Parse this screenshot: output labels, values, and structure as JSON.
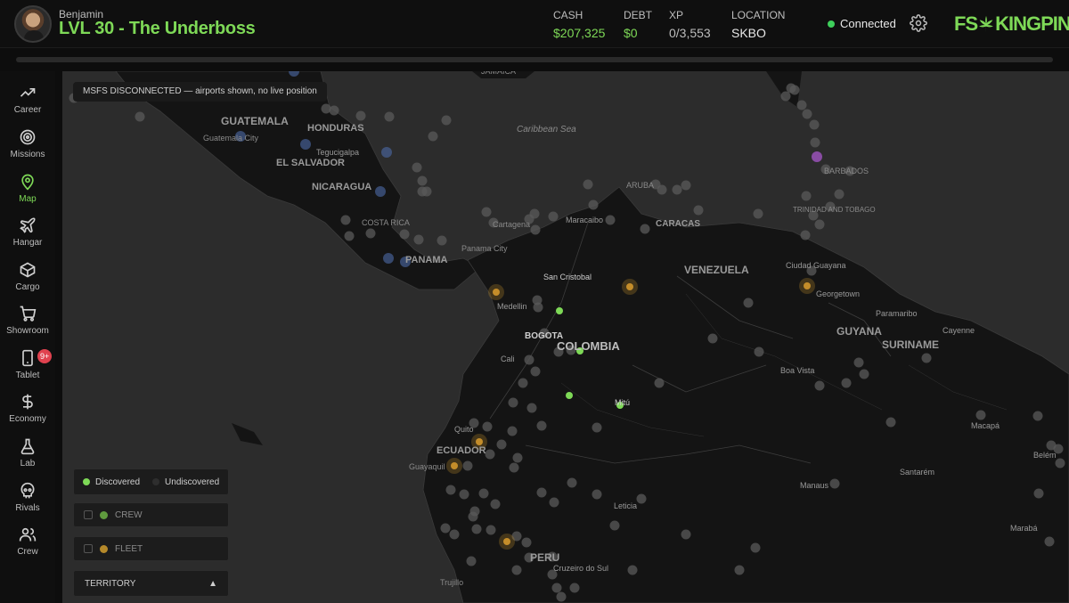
{
  "player": {
    "name": "Benjamin",
    "level_title": "LVL 30 - The Underboss"
  },
  "stats": {
    "cash_label": "CASH",
    "cash_value": "$207,325",
    "debt_label": "DEBT",
    "debt_value": "$0",
    "xp_label": "XP",
    "xp_value": "0/3,553",
    "location_label": "LOCATION",
    "location_value": "SKBO"
  },
  "status": {
    "connected_label": "Connected"
  },
  "brand": {
    "left": "FS",
    "right": "KINGPIN",
    "accent": "#7ed957"
  },
  "xp_progress": 0.0,
  "sidebar": {
    "items": [
      {
        "label": "Career",
        "icon": "trending-up-icon"
      },
      {
        "label": "Missions",
        "icon": "target-icon"
      },
      {
        "label": "Map",
        "icon": "map-pin-icon",
        "active": true
      },
      {
        "label": "Hangar",
        "icon": "plane-icon"
      },
      {
        "label": "Cargo",
        "icon": "box-icon"
      },
      {
        "label": "Showroom",
        "icon": "cart-icon"
      },
      {
        "label": "Tablet",
        "icon": "tablet-icon",
        "badge": "9+"
      },
      {
        "label": "Economy",
        "icon": "dollar-icon"
      },
      {
        "label": "Lab",
        "icon": "flask-icon"
      },
      {
        "label": "Rivals",
        "icon": "skull-icon"
      },
      {
        "label": "Crew",
        "icon": "users-icon"
      }
    ]
  },
  "map": {
    "banner": "MSFS DISCONNECTED — airports shown, no live position",
    "labels": [
      "JAMAICA",
      "GUATEMALA",
      "HONDURAS",
      "Guatemala City",
      "Tegucigalpa",
      "EL SALVADOR",
      "NICARAGUA",
      "COSTA RICA",
      "PANAMA",
      "Panama City",
      "Caribbean Sea",
      "ARUBA",
      "Cartagena",
      "Maracaibo",
      "CARACAS",
      "BARBADOS",
      "TRINIDAD AND TOBAGO",
      "VENEZUELA",
      "San Cristobal",
      "Ciudad Guayana",
      "Georgetown",
      "Paramaribo",
      "Cayenne",
      "GUYANA",
      "SURINAME",
      "Medellin",
      "BOGOTA",
      "COLOMBIA",
      "Cali",
      "Boa Vista",
      "Mitú",
      "Quito",
      "ECUADOR",
      "Guayaquil",
      "Macapá",
      "Belém",
      "Santarém",
      "Manaus",
      "Leticia",
      "PERU",
      "Cruzeiro do Sul",
      "Trujillo",
      "Marabá"
    ]
  },
  "legend": {
    "discovered_label": "Discovered",
    "discovered_color": "#7ed957",
    "undiscovered_label": "Undiscovered",
    "undiscovered_color": "#2e2e2e"
  },
  "filters": {
    "crew_label": "CREW",
    "crew_color": "#5f9a3e",
    "fleet_label": "FLEET",
    "fleet_color": "#b5892a",
    "territory_label": "TERRITORY",
    "territory_arrow": "▲"
  }
}
